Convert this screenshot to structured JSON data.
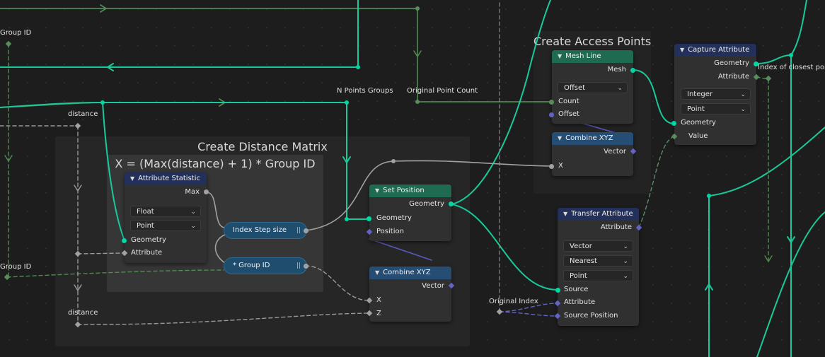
{
  "frames": {
    "distance_matrix": "Create Distance Matrix",
    "formula": "X = (Max(distance) + 1) * Group ID",
    "access_points": "Create Access Points"
  },
  "reroute_labels": {
    "group_id_top": "Group ID",
    "group_id_bottom": "Group ID",
    "distance_top": "distance",
    "distance_bottom": "distance",
    "n_points_groups": "N Points Groups",
    "original_point_count": "Original Point Count",
    "original_index": "Original Index",
    "index_closest_point": "Index of closest point"
  },
  "nodes": {
    "attribute_statistic": {
      "title": "Attribute Statistic",
      "out_max": "Max",
      "type": "Float",
      "domain": "Point",
      "in_geometry": "Geometry",
      "in_attribute": "Attribute"
    },
    "index_step": {
      "label": "Index Step size",
      "end_glyph": "||"
    },
    "group_mult": {
      "label": "* Group ID",
      "end_glyph": "||"
    },
    "set_position": {
      "title": "Set Position",
      "out_geometry": "Geometry",
      "in_geometry": "Geometry",
      "in_position": "Position"
    },
    "combine_xyz_1": {
      "title": "Combine XYZ",
      "out_vector": "Vector",
      "in_x": "X",
      "in_z": "Z"
    },
    "mesh_line": {
      "title": "Mesh Line",
      "out_mesh": "Mesh",
      "mode": "Offset",
      "in_count": "Count",
      "in_offset": "Offset"
    },
    "combine_xyz_2": {
      "title": "Combine XYZ",
      "out_vector": "Vector",
      "in_x": "X"
    },
    "transfer_attribute": {
      "title": "Transfer Attribute",
      "out_attribute": "Attribute",
      "data_type": "Vector",
      "mapping": "Nearest",
      "domain": "Point",
      "in_source": "Source",
      "in_attribute": "Attribute",
      "in_source_position": "Source Position"
    },
    "capture_attribute": {
      "title": "Capture Attribute",
      "out_geometry": "Geometry",
      "out_attribute": "Attribute",
      "data_type": "Integer",
      "domain": "Point",
      "in_geometry": "Geometry",
      "in_value": "Value"
    }
  },
  "icons": {
    "collapse": "chevron-down-icon",
    "dropdown": "chevron-down-icon"
  },
  "colors": {
    "geometry_socket": "#00d6a3",
    "float_socket": "#a1a1a1",
    "vector_socket": "#6363c7",
    "integer_socket": "#598c5c",
    "header_geometry": "#1f6b52",
    "header_vector": "#264d74",
    "header_attribute": "#23305a",
    "background": "#1d1d1d"
  }
}
